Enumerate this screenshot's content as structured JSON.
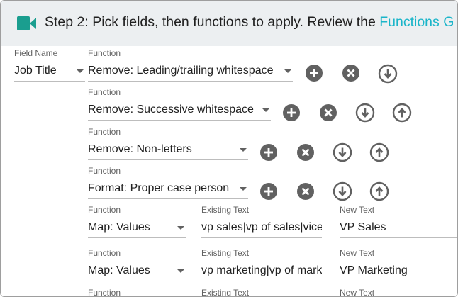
{
  "header": {
    "title": "Step 2: Pick fields, then functions to apply. Review the ",
    "link": "Functions G",
    "icon": "video-camera-icon",
    "accent_color": "#1ab5c9"
  },
  "field": {
    "label": "Field Name",
    "value": "Job Title"
  },
  "functions": [
    {
      "label": "Function",
      "value": "Remove: Leading/trailing whitespace"
    },
    {
      "label": "Function",
      "value": "Remove: Successive whitespace"
    },
    {
      "label": "Function",
      "value": "Remove: Non-letters"
    },
    {
      "label": "Function",
      "value": "Format: Proper case person"
    },
    {
      "label": "Function",
      "value": "Map: Values",
      "existing_label": "Existing Text",
      "existing_value": "vp sales|vp of sales|vice",
      "new_label": "New Text",
      "new_value": "VP Sales"
    },
    {
      "label": "Function",
      "value": "Map: Values",
      "existing_label": "Existing Text",
      "existing_value": "vp marketing|vp of mark",
      "new_label": "New Text",
      "new_value": "VP Marketing"
    },
    {
      "label": "Function",
      "existing_label": "Existing Text",
      "new_label": "New Text"
    }
  ],
  "icons": {
    "add": "add-circle-icon",
    "remove": "remove-circle-icon",
    "move_down": "arrow-down-circle-icon",
    "move_up": "arrow-up-circle-icon"
  }
}
